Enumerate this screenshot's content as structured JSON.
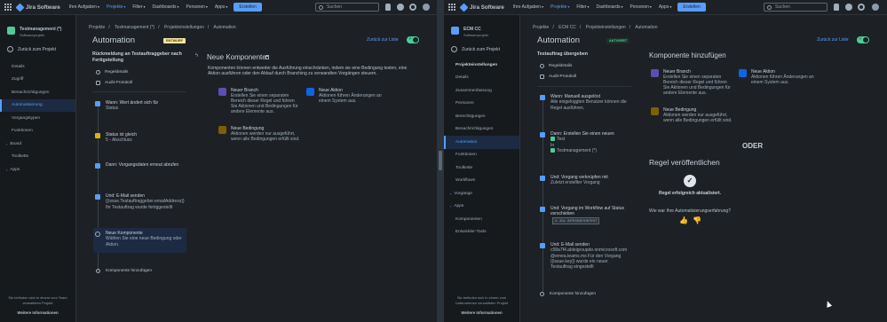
{
  "topbar": {
    "app_name": "Jira Software",
    "nav": [
      {
        "label": "Ihre Aufgaben"
      },
      {
        "label": "Projekte"
      },
      {
        "label": "Filter"
      },
      {
        "label": "Dashboards"
      },
      {
        "label": "Personen"
      },
      {
        "label": "Apps"
      }
    ],
    "create_label": "Erstellen",
    "search_placeholder": "Suchen"
  },
  "left": {
    "sidebar": {
      "project_name": "Testmanagement (*)",
      "project_type": "Softwareprojekt",
      "back_label": "Zurück zum Projekt",
      "items": [
        "Details",
        "Zugriff",
        "Benachrichtigungen",
        "Automatisierung",
        "Vorgangstypen",
        "Funktionen",
        "Board",
        "Toolkette",
        "Apps"
      ],
      "footer_text": "Sie befinden sich in einem vom Team verwalteten Projekt",
      "footer_link": "Weitere Informationen"
    },
    "breadcrumb": [
      "Projekte",
      "Testmanagement (*)",
      "Projekteinstellungen",
      "Automation"
    ],
    "title": "Automation",
    "status_lozenge": "ENTWURF",
    "back_to_list": "Zurück zur Liste",
    "rule_heading": "Rückmeldung an Testauftraggeber nach Fertigstellung",
    "rule_links": [
      "Regeldetails",
      "Audit-Protokoll"
    ],
    "steps": [
      {
        "title": "Wann: Wert ändert sich für",
        "sub": "Status"
      },
      {
        "title": "Status ist gleich",
        "sub": "5 - Abschluss"
      },
      {
        "title": "Dann: Vorgangsdaten erneut abrufen",
        "sub": ""
      },
      {
        "title": "Und: E-Mail senden",
        "sub": "{{issue.Testauftraggeber.emailAddress}} Ihr Testauftrag wurde fertiggestellt"
      },
      {
        "title": "Neue Komponente",
        "sub": "Wählen Sie eine neue Bedingung oder Aktion."
      }
    ],
    "add_component": "Komponente hinzufügen",
    "panel": {
      "title": "Neue Komponente",
      "description": "Komponenten können entweder die Ausführung einschränken, indem sie eine Bedingung testen, eine Aktion ausführen oder den Ablauf durch Branching zu verwandten Vorgängen steuern.",
      "components": [
        {
          "name": "Neuer Branch",
          "desc": "Erstellen Sie einen separaten Bereich dieser Regel und führen Sie Aktionen und Bedingungen für andere Elemente aus."
        },
        {
          "name": "Neue Aktion",
          "desc": "Aktionen führen Änderungen an einem System aus."
        },
        {
          "name": "Neue Bedingung",
          "desc": "Aktionen werden nur ausgeführt, wenn alle Bedingungen erfüllt sind."
        }
      ]
    }
  },
  "right": {
    "sidebar": {
      "project_name": "ECM CC",
      "project_type": "Softwareprojekt",
      "back_label": "Zurück zum Projekt",
      "items": [
        "Projekteinstellungen",
        "Details",
        "Zusammenfassung",
        "Personen",
        "Berechtigungen",
        "Benachrichtigungen",
        "Automation",
        "Funktionen",
        "Toolkette",
        "Workflows",
        "Vorgänge",
        "Apps",
        "Komponenten",
        "Entwickler-Tools"
      ],
      "footer_text": "Sie befinden sich in einem vom Unternehmen verwalteten Projekt",
      "footer_link": "Weitere Informationen"
    },
    "breadcrumb": [
      "Projekte",
      "ECM CC",
      "Projekteinstellungen",
      "Automation"
    ],
    "title": "Automation",
    "status_lozenge": "AKTIVIERT",
    "back_to_list": "Zurück zur Liste",
    "rule_heading": "Testauftrag übergeben",
    "rule_links": [
      "Regeldetails",
      "Audit-Protokoll"
    ],
    "steps": [
      {
        "title": "Wann: Manuell ausgelöst",
        "sub": "Alle eingeloggten Benutzer können die Regel ausführen."
      },
      {
        "title": "Dann: Erstellen Sie einen neuen",
        "line2": "Test",
        "line3": "In",
        "line4": "Testmanagement (*)"
      },
      {
        "title": "Und: Vorgang verknüpfen mit",
        "sub": "Zuletzt erstellter Vorgang"
      },
      {
        "title": "Und: Vorgang im Workflow auf Status verschieben",
        "tag": "4 - ZUL. INTEGRATIONTEST"
      },
      {
        "title": "Und: E-Mail senden",
        "sub": "c58a7f4.ableigroupde.onmicrosoft.com @emea.teams.ms Für den Vorgang {{issue.key}} wurde ein neuer Testauftrag eingestellt"
      }
    ],
    "add_component": "Komponente hinzufügen",
    "panel": {
      "title": "Komponente hinzufügen",
      "components": [
        {
          "name": "Neuer Branch",
          "desc": "Erstellen Sie einen separaten Bereich dieser Regel und führen Sie Aktionen und Bedingungen für andere Elemente aus."
        },
        {
          "name": "Neue Aktion",
          "desc": "Aktionen führen Änderungen an einem System aus."
        },
        {
          "name": "Neue Bedingung",
          "desc": "Aktionen werden nur ausgeführt, wenn alle Bedingungen erfüllt sind."
        }
      ],
      "or_label": "ODER",
      "publish_title": "Regel veröffentlichen",
      "publish_msg": "Regel erfolgreich aktualisiert.",
      "feedback_q": "Wie war Ihre Automatisierungserfahrung?"
    }
  },
  "colors": {
    "accent": "#579dff",
    "success": "#4bce97",
    "draft_lozenge": "#f8e6a0",
    "active_lozenge": "#4bce97",
    "branch": "#9f8fef",
    "action": "#579dff",
    "condition": "#e2b203",
    "trigger": "#579dff"
  }
}
